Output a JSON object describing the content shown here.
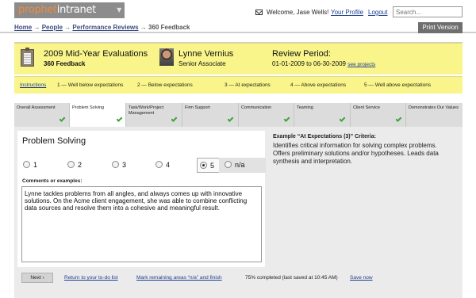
{
  "app": {
    "logo_part1": "prophet",
    "logo_part2": "intranet",
    "logo_arrow": "▼"
  },
  "user": {
    "welcome": "Welcome, Jase Wells!",
    "profile_link": "Your Profile",
    "logout_link": "Logout"
  },
  "search": {
    "placeholder": "Search..."
  },
  "breadcrumb": {
    "items": [
      "Home",
      "People",
      "Performance Reviews"
    ],
    "separator": "→",
    "current": "360 Feedback"
  },
  "print_button": "Print Version",
  "header": {
    "title": "2009 Mid-Year Evaluations",
    "subtitle": "360 Feedback",
    "reviewee_name": "Lynne Vernius",
    "reviewee_role": "Senior Associate",
    "period_title": "Review Period:",
    "period_dates": "01-01-2009 to 06-30-2009",
    "see_projects": "see projects"
  },
  "scale": {
    "instructions": "Instructions",
    "items": [
      "1 — Well below expectations",
      "2 — Below expectations",
      "3 — At expectations",
      "4 — Above expectations",
      "5 — Well above expectations"
    ]
  },
  "tabs": [
    {
      "label": "Overall Assessment",
      "checked": true
    },
    {
      "label": "Problem Solving",
      "checked": true,
      "active": true
    },
    {
      "label": "Task/Work/Project Management",
      "checked": true
    },
    {
      "label": "Firm Support",
      "checked": true
    },
    {
      "label": "Communication",
      "checked": true
    },
    {
      "label": "Teaming",
      "checked": true
    },
    {
      "label": "Client Service",
      "checked": true
    },
    {
      "label": "Demonstrates Our Values",
      "checked": false
    }
  ],
  "section": {
    "title": "Problem Solving",
    "ratings": [
      "1",
      "2",
      "3",
      "4",
      "5",
      "n/a"
    ],
    "selected_rating": "5",
    "comments_label": "Comments or examples:",
    "comment_text": "Lynne tackles problems from all angles, and always comes up with innovative solutions. On the Acme client engagement, she was able to combine conflicting data sources and resolve them into a cohesive and meaningful result."
  },
  "criteria": {
    "title": "Example “At Expectations (3)” Criteria:",
    "text": "Identifies critical information for solving complex problems. Offers preliminary solutions and/or hypotheses. Leads data synthesis and interpretation."
  },
  "footer": {
    "next_button": "Next ›",
    "return_link": "Return to your to-do list",
    "mark_na_link": "Mark remaining areas “n/a” and finish",
    "status": "75% completed (last saved at 10:45 AM)",
    "save_link": "Save now"
  },
  "colors": {
    "header_yellow": "#f9f58a",
    "check_green": "#3aa43a",
    "logo_orange": "#f08a3a",
    "logo_gray": "#8c8c8c"
  }
}
